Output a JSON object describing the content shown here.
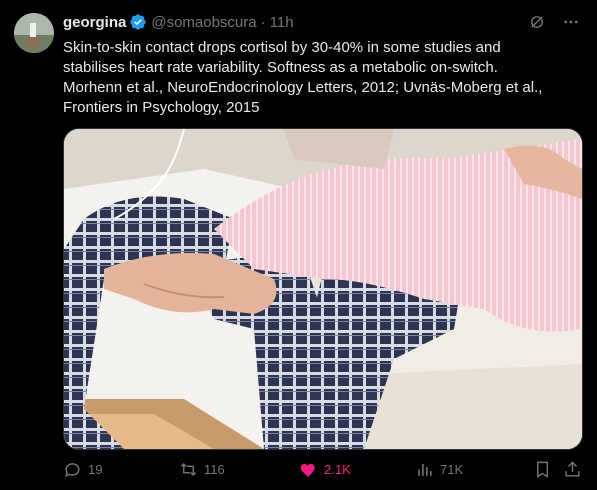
{
  "post": {
    "display_name": "georgina",
    "handle": "@somaobscura",
    "separator": "·",
    "time": "11h",
    "text_lines": [
      "Skin-to-skin contact drops cortisol by 30-40% in some studies and",
      "stabilises heart rate variability.  Softness as a metabolic on-switch.",
      " Morhenn et al., NeuroEndocrinology Letters, 2012; Uvnäs-Moberg et al.,",
      "Frontiers in Psychology, 2015"
    ],
    "media_alt": "Photo of two people in pajamas with legs intertwined on a bed"
  },
  "actions": {
    "replies": "19",
    "reposts": "116",
    "likes": "2.1K",
    "views": "71K"
  },
  "colors": {
    "background": "#000000",
    "text": "#e7e9ea",
    "muted": "#71767b",
    "like": "#f91880",
    "verified": "#1d9bf0"
  },
  "icons": [
    "verified-badge-icon",
    "grok-icon",
    "more-icon",
    "reply-icon",
    "repost-icon",
    "like-icon",
    "views-icon",
    "bookmark-icon",
    "share-icon"
  ]
}
